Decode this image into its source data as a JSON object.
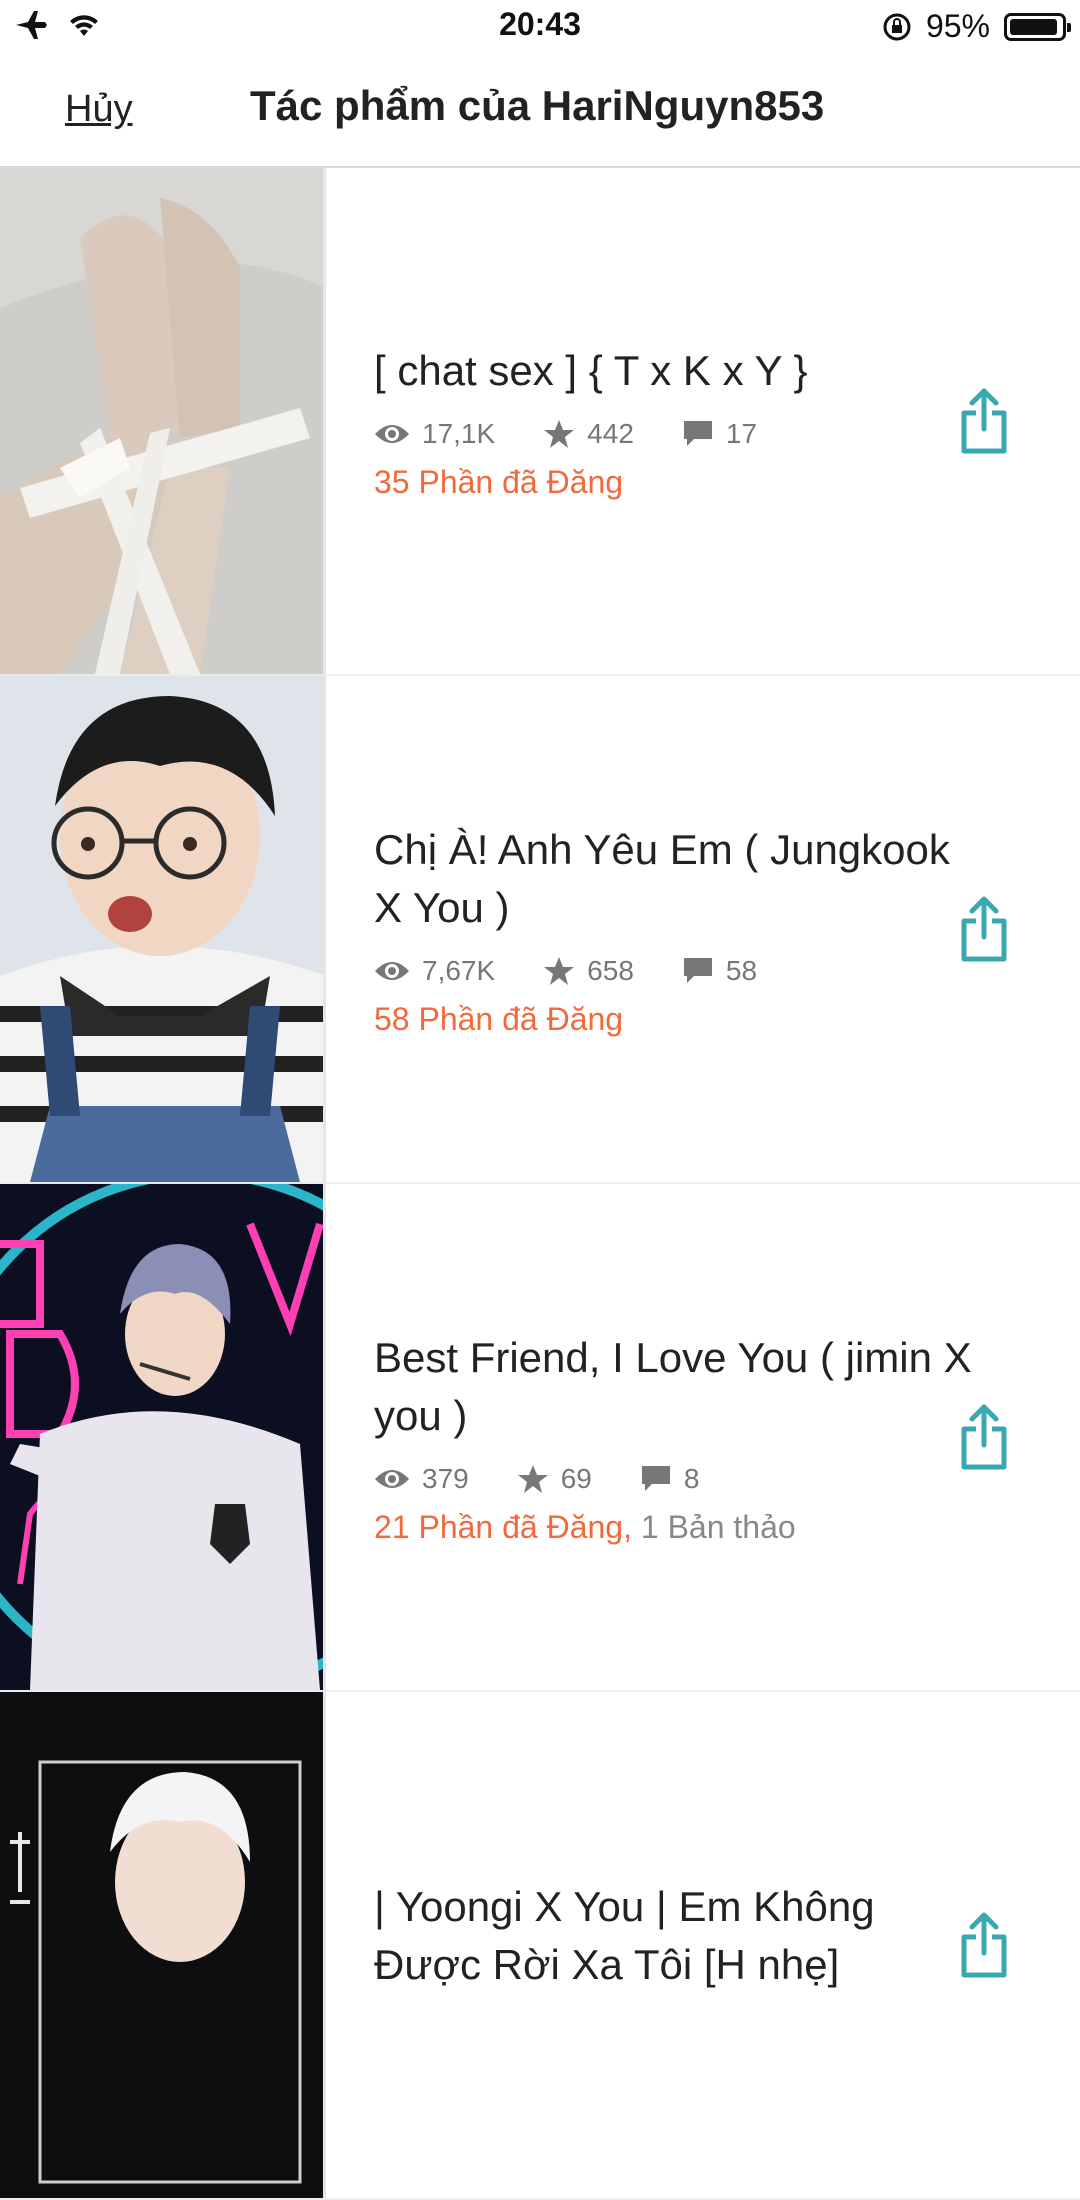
{
  "status_bar": {
    "time": "20:43",
    "battery": "95%",
    "battery_level": 0.95
  },
  "nav": {
    "cancel_label": "Hủy",
    "title": "Tác phẩm của HariNguyn853"
  },
  "colors": {
    "accent_orange": "#f26a3b",
    "share_teal": "#3aa8b0",
    "stat_gray": "#777777"
  },
  "stories": [
    {
      "title": "[ chat sex ] { T x K x Y }",
      "views": "17,1K",
      "votes": "442",
      "comments": "17",
      "parts": "35 Phần đã Đăng",
      "drafts": ""
    },
    {
      "title": "Chị À! Anh Yêu Em ( Jungkook X You )",
      "views": "7,67K",
      "votes": "658",
      "comments": "58",
      "parts": "58 Phần đã Đăng",
      "drafts": ""
    },
    {
      "title": "Best Friend, I Love You ( jimin X you )",
      "views": "379",
      "votes": "69",
      "comments": "8",
      "parts": "21 Phần đã Đăng,",
      "drafts": " 1 Bản thảo"
    },
    {
      "title": "| Yoongi X You | Em Không Được Rời Xa Tôi [H nhẹ]",
      "views": "",
      "votes": "",
      "comments": "",
      "parts": "",
      "drafts": ""
    }
  ]
}
